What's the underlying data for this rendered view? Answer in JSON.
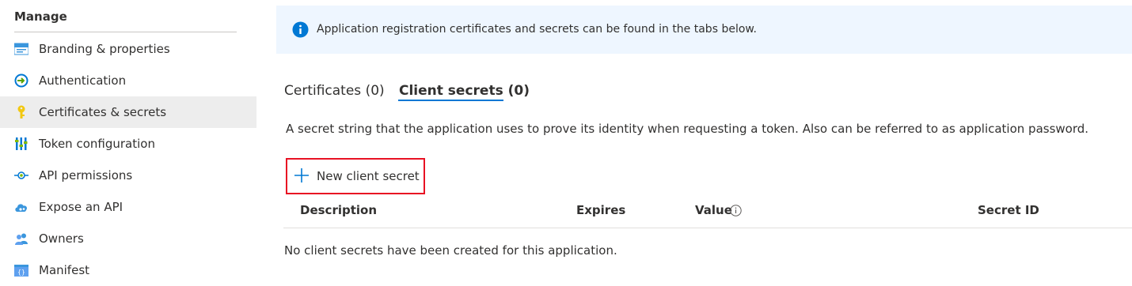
{
  "sidebar": {
    "section_title": "Manage",
    "items": [
      {
        "label": "Branding & properties",
        "icon": "branding-icon",
        "active": false
      },
      {
        "label": "Authentication",
        "icon": "authentication-icon",
        "active": false
      },
      {
        "label": "Certificates & secrets",
        "icon": "key-icon",
        "active": true
      },
      {
        "label": "Token configuration",
        "icon": "token-config-icon",
        "active": false
      },
      {
        "label": "API permissions",
        "icon": "api-permissions-icon",
        "active": false
      },
      {
        "label": "Expose an API",
        "icon": "cloud-api-icon",
        "active": false
      },
      {
        "label": "Owners",
        "icon": "owners-icon",
        "active": false
      },
      {
        "label": "Manifest",
        "icon": "manifest-icon",
        "active": false
      }
    ]
  },
  "banner": {
    "text": "Application registration certificates and secrets can be found in the tabs below.",
    "icon": "info-icon"
  },
  "tabs": [
    {
      "label": "Certificates (0)",
      "selected": false
    },
    {
      "label": "Client secrets (0)",
      "selected": true
    }
  ],
  "description": "A secret string that the application uses to prove its identity when requesting a token. Also can be referred to as application password.",
  "toolbar": {
    "new_secret_label": "New client secret"
  },
  "table": {
    "columns": [
      "Description",
      "Expires",
      "Value",
      "Secret ID"
    ],
    "empty_message": "No client secrets have been created for this application."
  },
  "colors": {
    "accent": "#0078d4",
    "highlight_border": "#e81123",
    "banner_bg": "#eef6ff",
    "active_nav_bg": "#ededed"
  }
}
